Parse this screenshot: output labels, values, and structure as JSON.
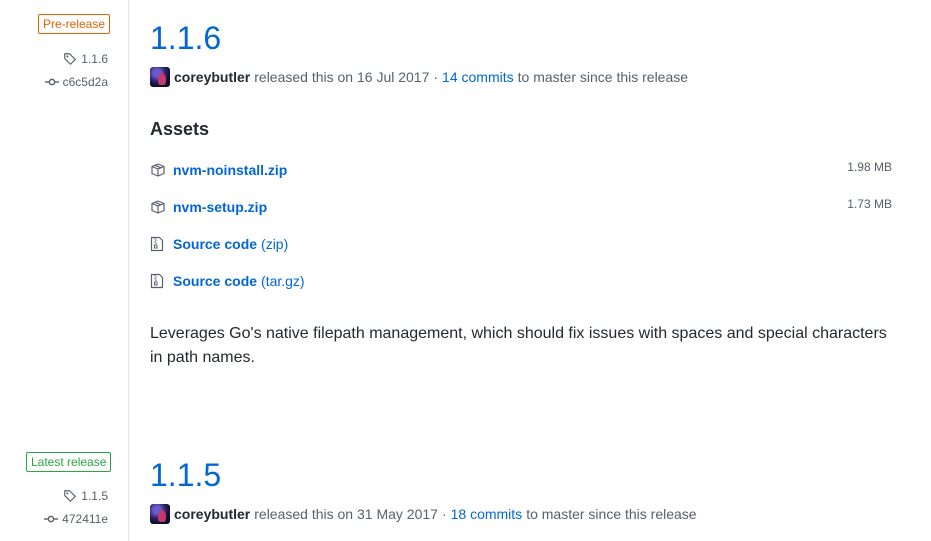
{
  "releases": [
    {
      "label": "Pre-release",
      "tag": "1.1.6",
      "commit": "c6c5d2a",
      "title": "1.1.6",
      "author": "coreybutler",
      "released_text": "released this on 16 Jul 2017",
      "separator": "·",
      "commits_link": "14 commits",
      "commits_suffix": "to master since this release",
      "assets_heading": "Assets",
      "assets": [
        {
          "name": "nvm-noinstall.zip",
          "suffix": "",
          "size": "1.98 MB",
          "icon": "package-icon"
        },
        {
          "name": "nvm-setup.zip",
          "suffix": "",
          "size": "1.73 MB",
          "icon": "package-icon"
        },
        {
          "name": "Source code",
          "suffix": "(zip)",
          "size": "",
          "icon": "file-zip-icon"
        },
        {
          "name": "Source code",
          "suffix": "(tar.gz)",
          "size": "",
          "icon": "file-zip-icon"
        }
      ],
      "body": "Leverages Go's native filepath management, which should fix issues with spaces and special characters in path names."
    },
    {
      "label": "Latest release",
      "tag": "1.1.5",
      "commit": "472411e",
      "title": "1.1.5",
      "author": "coreybutler",
      "released_text": "released this on 31 May 2017",
      "separator": "·",
      "commits_link": "18 commits",
      "commits_suffix": "to master since this release"
    }
  ],
  "colors": {
    "prerelease": "#e36209",
    "latest": "#28a745",
    "link": "#0366d6",
    "muted": "#586069",
    "text": "#24292e"
  }
}
